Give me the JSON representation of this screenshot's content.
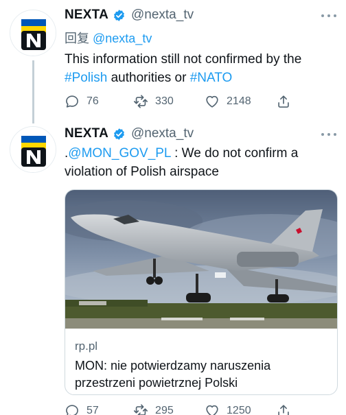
{
  "tweets": [
    {
      "author_name": "NEXTA",
      "handle": "@nexta_tv",
      "reply_prefix": "回复",
      "reply_to": "@nexta_tv",
      "text_1": "This information still not confirmed by the",
      "text_hashtag_1": "#Polish",
      "text_2": " authorities or ",
      "text_hashtag_2": "#NATO",
      "replies": "76",
      "retweets": "330",
      "likes": "2148"
    },
    {
      "author_name": "NEXTA",
      "handle": "@nexta_tv",
      "text_prefix": ".",
      "text_mention": "@MON_GOV_PL",
      "text_rest": " : We do not confirm a violation of Polish airspace",
      "card": {
        "domain": "rp.pl",
        "title": "MON: nie potwierdzamy naruszenia przestrzeni powietrznej Polski"
      },
      "replies": "57",
      "retweets": "295",
      "likes": "1250"
    }
  ],
  "colors": {
    "accent": "#1d9bf0",
    "text": "#0f1419",
    "muted": "#536471",
    "avatar_blue": "#0057b8",
    "avatar_yellow": "#ffd700"
  },
  "icons": {
    "avatar": "nexta-logo",
    "verified": "verified-badge-icon",
    "reply": "reply-icon",
    "retweet": "retweet-icon",
    "like": "heart-icon",
    "share": "share-icon",
    "more": "more-icon"
  }
}
